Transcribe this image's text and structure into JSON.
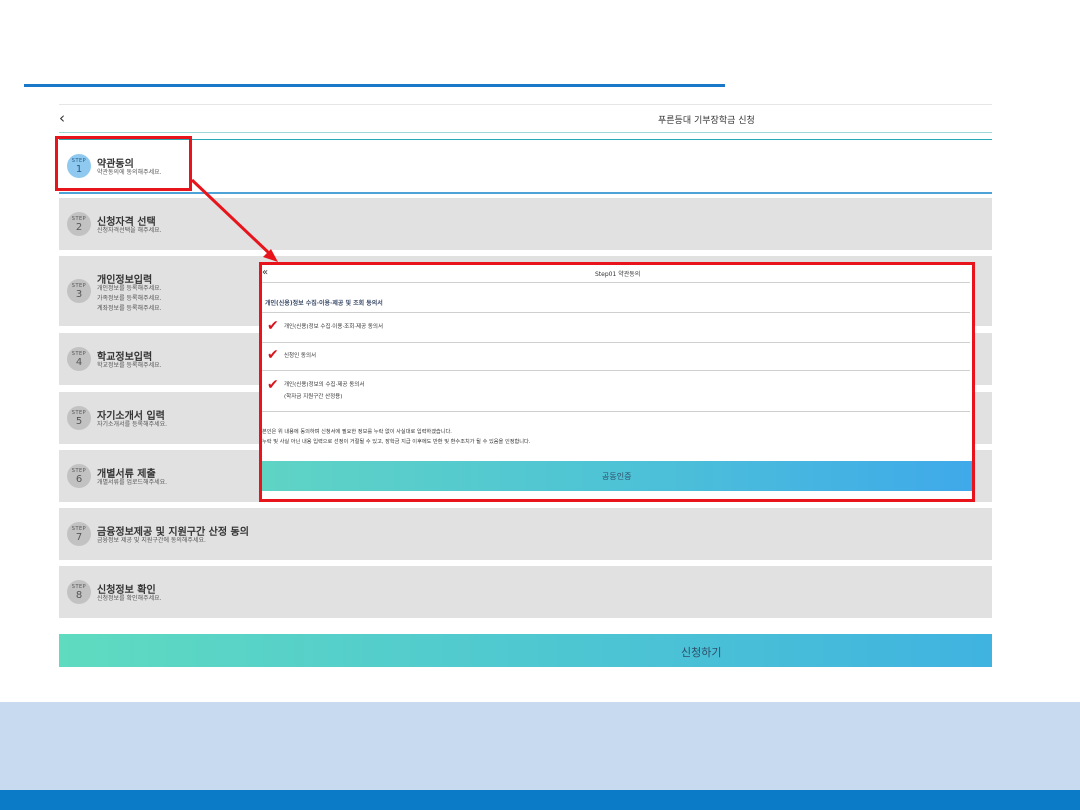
{
  "header": {
    "back_icon": "chevron-left-icon",
    "title": "푸른등대 기부장학금 신청"
  },
  "steps": [
    {
      "step": "STEP",
      "number": "1",
      "title": "약관동의",
      "desc": [
        "약관동의에 동의해주세요."
      ],
      "active": true
    },
    {
      "step": "STEP",
      "number": "2",
      "title": "신청자격 선택",
      "desc": [
        "신청자격선택을 해주세요."
      ],
      "active": false
    },
    {
      "step": "STEP",
      "number": "3",
      "title": "개인정보입력",
      "desc": [
        "개인정보를 등록해주세요.",
        "가족정보를 등록해주세요.",
        "계좌정보를 등록해주세요."
      ],
      "active": false
    },
    {
      "step": "STEP",
      "number": "4",
      "title": "학교정보입력",
      "desc": [
        "학교정보를 등록해주세요."
      ],
      "active": false
    },
    {
      "step": "STEP",
      "number": "5",
      "title": "자기소개서 입력",
      "desc": [
        "자기소개서를 등록해주세요."
      ],
      "active": false
    },
    {
      "step": "STEP",
      "number": "6",
      "title": "개별서류 제출",
      "desc": [
        "개별서류를 업로드해주세요."
      ],
      "active": false
    },
    {
      "step": "STEP",
      "number": "7",
      "title": "금융정보제공 및 지원구간 산정 동의",
      "desc": [
        "금융정보 제공 및 지원구간에 동의해주세요."
      ],
      "active": false
    },
    {
      "step": "STEP",
      "number": "8",
      "title": "신청정보 확인",
      "desc": [
        "신청정보를 확인해주세요."
      ],
      "active": false
    }
  ],
  "apply_button": "신청하기",
  "popup": {
    "back_icon": "double-chevron-left-icon",
    "title": "Step01 약관동의",
    "heading": "개인(신용)정보 수집·이용·제공 및 조회 동의서",
    "consents": [
      {
        "lines": [
          "개인(신용)정보 수집·이용·조회·제공 동의서"
        ],
        "checked": true
      },
      {
        "lines": [
          "신청인 동의서"
        ],
        "checked": true
      },
      {
        "lines": [
          "개인(신용)정보의 수집·제공 동의서",
          "(학자금 지원구간 산정용)"
        ],
        "checked": true
      }
    ],
    "notice": [
      "본인은 위 내용에 동의하며 신청서에 필요한 정보를 누락 없이 사실대로 입력하겠습니다.",
      "누락 및 사실 아닌 내용 입력으로 선정이 거절될 수 있고, 장학금 지급 이후에도 반환 및 환수조치가 될 수 있음을 인정합니다."
    ],
    "auth_button": "공동인증"
  },
  "colors": {
    "highlight": "#e8141c",
    "accent_blue": "#1a78c8",
    "button_gradient_start": "#5fdbc0",
    "button_gradient_end": "#40b3e0",
    "footer_band": "#c7daf0",
    "footer_bar": "#0b7bc7"
  },
  "annotation": {
    "arrow_icon": "red-arrow-icon"
  }
}
